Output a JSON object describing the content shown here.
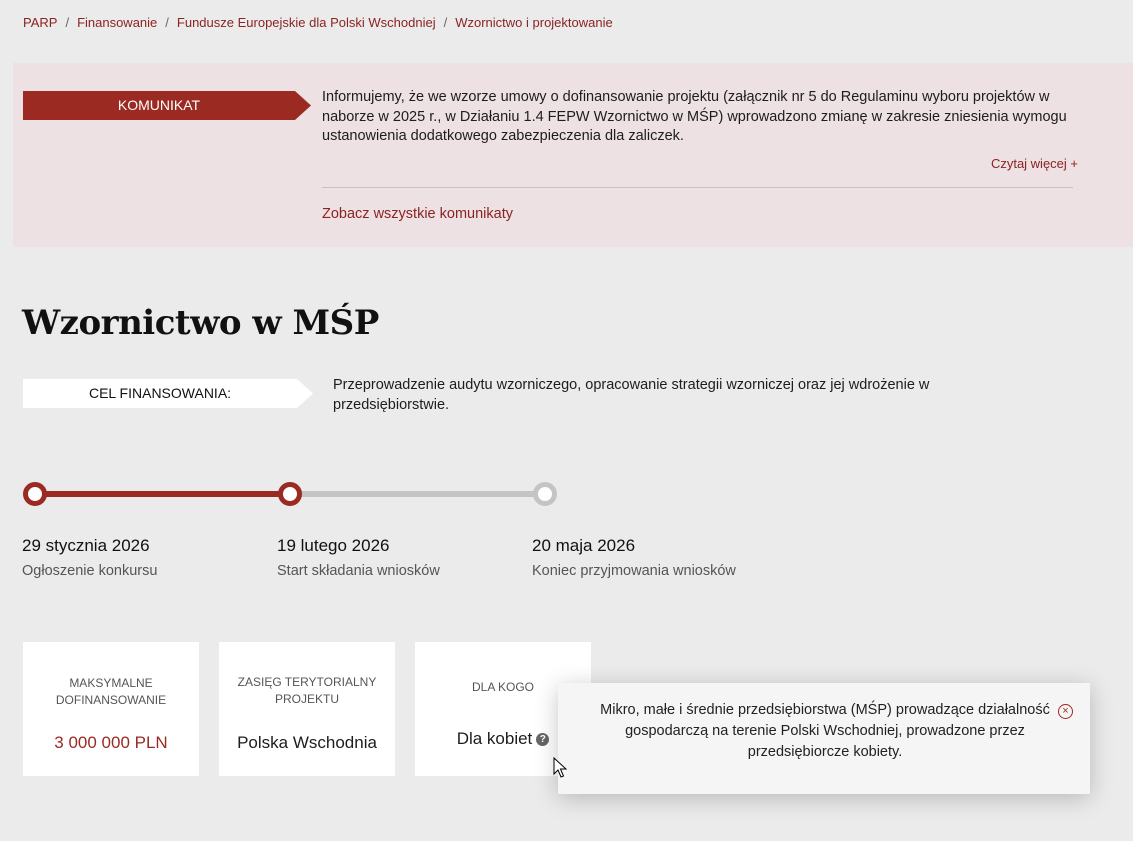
{
  "breadcrumb": [
    "PARP",
    "Finansowanie",
    "Fundusze Europejskie dla Polski Wschodniej",
    "Wzornictwo i projektowanie"
  ],
  "notice": {
    "label": "KOMUNIKAT",
    "text": "Informujemy, że we wzorze umowy o dofinansowanie projektu (załącznik nr 5 do Regulaminu wyboru projektów w naborze w 2025 r., w Działaniu 1.4 FEPW Wzornictwo w MŚP) wprowadzono zmianę w zakresie zniesienia wymogu ustanowienia dodatkowego zabezpieczenia dla zaliczek.",
    "read_more": "Czytaj więcej +",
    "see_all": "Zobacz wszystkie komunikaty"
  },
  "page_title": "Wzornictwo w MŚP",
  "goal": {
    "label": "CEL FINANSOWANIA:",
    "text": "Przeprowadzenie audytu wzorniczego, opracowanie strategii wzorniczej oraz jej wdrożenie w przedsiębiorstwie."
  },
  "timeline": [
    {
      "date": "29 stycznia 2026",
      "label": "Ogłoszenie konkursu",
      "state": "done"
    },
    {
      "date": "19 lutego 2026",
      "label": "Start składania wniosków",
      "state": "current"
    },
    {
      "date": "20 maja 2026",
      "label": "Koniec przyjmowania wniosków",
      "state": "upcoming"
    }
  ],
  "cards": [
    {
      "label": "MAKSYMALNE DOFINANSOWANIE",
      "value": "3 000 000 PLN"
    },
    {
      "label": "ZASIĘG TERYTORIALNY PROJEKTU",
      "value": "Polska Wschodnia"
    },
    {
      "label": "DLA KOGO",
      "value": "Dla kobiet"
    }
  ],
  "help_icon_glyph": "?",
  "tooltip": {
    "text": "Mikro, małe i średnie przedsiębiorstwa (MŚP) prowadzące działalność gospodarczą na terenie Polski Wschodniej, prowadzone przez przedsiębiorcze kobiety.",
    "close_glyph": "×"
  },
  "colors": {
    "accent": "#9b2a22",
    "notice_bg": "#ede1e3",
    "page_bg": "#ebebeb"
  }
}
